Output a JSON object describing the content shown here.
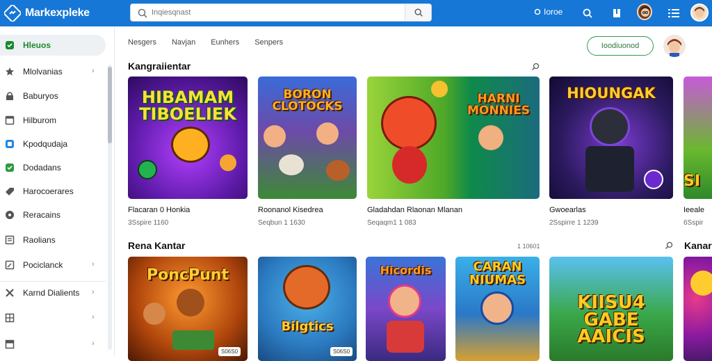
{
  "app": {
    "brand_name": "Markexpleke",
    "search_placeholder": "Inqiesqnast",
    "home_label": "Ioroe",
    "colors": {
      "topbar": "#1677d6",
      "accent": "#1a8a2e",
      "cta_border": "#2d9a4f"
    }
  },
  "sidebar": {
    "items": [
      {
        "label": "Hleuos",
        "icon": "shield-check-icon",
        "active": true
      },
      {
        "label": "Mlolvanias",
        "icon": "star-icon",
        "chevron": true
      },
      {
        "label": "Baburyos",
        "icon": "lock-icon"
      },
      {
        "label": "Hilburom",
        "icon": "window-icon"
      },
      {
        "label": "Kpodqudaja",
        "icon": "app-icon"
      },
      {
        "label": "Dodadans",
        "icon": "check-box-icon"
      },
      {
        "label": "Harocoerares",
        "icon": "tag-icon"
      },
      {
        "label": "Reracains",
        "icon": "badge-icon"
      },
      {
        "label": "Raolians",
        "icon": "list-icon"
      },
      {
        "label": "Pociclanck",
        "icon": "edit-icon",
        "chevron": true
      },
      {
        "label": "Karnd Dialients",
        "icon": "tools-icon",
        "chevron": true
      },
      {
        "label": "",
        "icon": "grid-icon",
        "chevron": true
      },
      {
        "label": "",
        "icon": "folder-icon",
        "chevron": true
      }
    ]
  },
  "main": {
    "tabs": [
      "Nesgers",
      "Navjan",
      "Eunhers",
      "Senpers"
    ],
    "cta_label": "Ioodiuonod",
    "sections": [
      {
        "title": "Kangraiientar",
        "aux": "",
        "cards": [
          {
            "thumb_title": "HIBAMAM TIBOELIEK",
            "name": "Flacaran 0 Honkia",
            "meta": "3Sspire 1160"
          },
          {
            "thumb_title": "BORON CLOTOCKS",
            "name": "Roonanol Kisedrea",
            "meta": "Seqbun 1 1630"
          },
          {
            "thumb_title": "HARNI MONNIES",
            "name": "Gladahdan Rlaonan Mlanan",
            "meta": "Seqaqm1 1 083"
          },
          {
            "thumb_title": "HIOUNGAK",
            "name": "Gwoearlas",
            "meta": "2Sspirre 1 1239"
          },
          {
            "thumb_title": "SI",
            "name": "Ieeale",
            "meta": "6Sspir"
          }
        ]
      },
      {
        "title": "Rena Kantar",
        "aux": "1 10601",
        "cards": [
          {
            "thumb_title": "PoncPunt",
            "name": "",
            "meta": "",
            "badge": "S06S0"
          },
          {
            "thumb_title": "Bilgtics",
            "name": "",
            "meta": "",
            "badge": "S06S0"
          },
          {
            "thumb_title": "Hicordis",
            "name": "",
            "meta": ""
          },
          {
            "thumb_title": "CARAN NIUMAS",
            "name": "",
            "meta": ""
          },
          {
            "thumb_title": "KIISU4 GABE AAICIS",
            "name": "",
            "meta": ""
          },
          {
            "thumb_title": "Kanar",
            "name": "",
            "meta": ""
          }
        ]
      }
    ]
  }
}
